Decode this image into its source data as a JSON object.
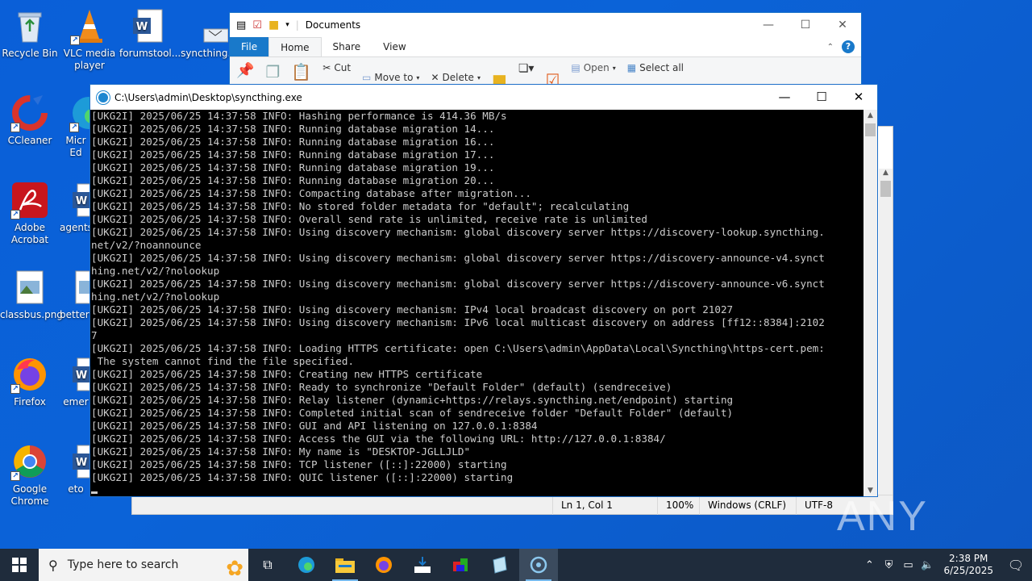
{
  "desktop": {
    "icons": [
      {
        "label": "Recycle Bin"
      },
      {
        "label": "VLC media player"
      },
      {
        "label": "forumstool..."
      },
      {
        "label": "syncthing..."
      },
      {
        "label": "CCleaner"
      },
      {
        "label": "Micr Ed"
      },
      {
        "label": "Adobe Acrobat"
      },
      {
        "label": "agents"
      },
      {
        "label": "classbus.png"
      },
      {
        "label": "betters"
      },
      {
        "label": "Firefox"
      },
      {
        "label": "emer"
      },
      {
        "label": "Google Chrome"
      },
      {
        "label": "eto"
      }
    ]
  },
  "explorer": {
    "title": "Documents",
    "tabs": [
      "File",
      "Home",
      "Share",
      "View"
    ],
    "ribbon": {
      "cut": "Cut",
      "move_to": "Move to",
      "delete": "Delete",
      "open": "Open",
      "select_all": "Select all"
    }
  },
  "notepad": {
    "status": {
      "position": "Ln 1, Col 1",
      "zoom": "100%",
      "line_ending": "Windows (CRLF)",
      "encoding": "UTF-8"
    }
  },
  "console": {
    "title": "C:\\Users\\admin\\Desktop\\syncthing.exe",
    "lines": [
      "[UKG2I] 2025/06/25 14:37:58 INFO: Hashing performance is 414.36 MB/s",
      "[UKG2I] 2025/06/25 14:37:58 INFO: Running database migration 14...",
      "[UKG2I] 2025/06/25 14:37:58 INFO: Running database migration 16...",
      "[UKG2I] 2025/06/25 14:37:58 INFO: Running database migration 17...",
      "[UKG2I] 2025/06/25 14:37:58 INFO: Running database migration 19...",
      "[UKG2I] 2025/06/25 14:37:58 INFO: Running database migration 20...",
      "[UKG2I] 2025/06/25 14:37:58 INFO: Compacting database after migration...",
      "[UKG2I] 2025/06/25 14:37:58 INFO: No stored folder metadata for \"default\"; recalculating",
      "[UKG2I] 2025/06/25 14:37:58 INFO: Overall send rate is unlimited, receive rate is unlimited",
      "[UKG2I] 2025/06/25 14:37:58 INFO: Using discovery mechanism: global discovery server https://discovery-lookup.syncthing.",
      "net/v2/?noannounce",
      "[UKG2I] 2025/06/25 14:37:58 INFO: Using discovery mechanism: global discovery server https://discovery-announce-v4.synct",
      "hing.net/v2/?nolookup",
      "[UKG2I] 2025/06/25 14:37:58 INFO: Using discovery mechanism: global discovery server https://discovery-announce-v6.synct",
      "hing.net/v2/?nolookup",
      "[UKG2I] 2025/06/25 14:37:58 INFO: Using discovery mechanism: IPv4 local broadcast discovery on port 21027",
      "[UKG2I] 2025/06/25 14:37:58 INFO: Using discovery mechanism: IPv6 local multicast discovery on address [ff12::8384]:2102",
      "7",
      "[UKG2I] 2025/06/25 14:37:58 INFO: Loading HTTPS certificate: open C:\\Users\\admin\\AppData\\Local\\Syncthing\\https-cert.pem:",
      " The system cannot find the file specified.",
      "[UKG2I] 2025/06/25 14:37:58 INFO: Creating new HTTPS certificate",
      "[UKG2I] 2025/06/25 14:37:58 INFO: Ready to synchronize \"Default Folder\" (default) (sendreceive)",
      "[UKG2I] 2025/06/25 14:37:58 INFO: Relay listener (dynamic+https://relays.syncthing.net/endpoint) starting",
      "[UKG2I] 2025/06/25 14:37:58 INFO: Completed initial scan of sendreceive folder \"Default Folder\" (default)",
      "[UKG2I] 2025/06/25 14:37:58 INFO: GUI and API listening on 127.0.0.1:8384",
      "[UKG2I] 2025/06/25 14:37:58 INFO: Access the GUI via the following URL: http://127.0.0.1:8384/",
      "[UKG2I] 2025/06/25 14:37:58 INFO: My name is \"DESKTOP-JGLLJLD\"",
      "[UKG2I] 2025/06/25 14:37:58 INFO: TCP listener ([::]:22000) starting",
      "[UKG2I] 2025/06/25 14:37:58 INFO: QUIC listener ([::]:22000) starting"
    ]
  },
  "watermark": "ANY RUN",
  "taskbar": {
    "search_placeholder": "Type here to search",
    "time": "2:38 PM",
    "date": "6/25/2025",
    "apps": [
      "task-view",
      "edge",
      "file-explorer",
      "firefox",
      "app-installer",
      "app-colorful",
      "notepad-app",
      "syncthing"
    ]
  },
  "colors": {
    "desktop": "#0b63d8",
    "console_text": "#cccccc",
    "taskbar": "#1f2c3c",
    "accent": "#1979ca"
  }
}
